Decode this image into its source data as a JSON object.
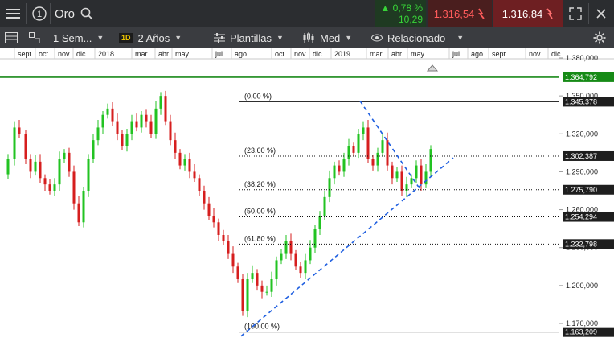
{
  "topbar": {
    "instrument": "Oro",
    "change_pct": "0,78 %",
    "change_abs": "10,29",
    "sell_price": "1.316,54",
    "buy_price": "1.316,84",
    "colors": {
      "sell_bg": "#4a1e1e",
      "buy_bg": "#6e1f22",
      "change_bg": "#1f3a22"
    }
  },
  "toolbar": {
    "period": "1 Sem...",
    "interval_badge": "1D",
    "range": "2 Años",
    "templates": "Plantillas",
    "chart_type": "Med",
    "related": "Relacionado"
  },
  "chart_data": {
    "type": "candlestick",
    "x_labels": [
      "sept.",
      "oct.",
      "nov.",
      "dic.",
      "2018",
      "mar.",
      "abr.",
      "may.",
      "jul.",
      "ago.",
      "oct.",
      "nov.",
      "dic.",
      "2019",
      "mar.",
      "abr.",
      "may.",
      "jul.",
      "ago.",
      "sept.",
      "nov.",
      "dic."
    ],
    "y_ticks": [
      "1.380,000",
      "1.350,000",
      "1.320,000",
      "1.290,000",
      "1.260,000",
      "1.230,000",
      "1.200,000",
      "1.170,000"
    ],
    "y_tick_values": [
      1380,
      1350,
      1320,
      1290,
      1260,
      1230,
      1200,
      1170
    ],
    "ylim": [
      1160,
      1390
    ],
    "price_tags": [
      {
        "label": "1.364,792",
        "value": 1364.792,
        "style": "green"
      },
      {
        "label": "1.345,378",
        "value": 1345.378,
        "style": "dark"
      },
      {
        "label": "1.302,387",
        "value": 1302.387,
        "style": "dark"
      },
      {
        "label": "1.275,790",
        "value": 1275.79,
        "style": "dark"
      },
      {
        "label": "1.254,294",
        "value": 1254.294,
        "style": "dark"
      },
      {
        "label": "1.232,798",
        "value": 1232.798,
        "style": "dark"
      },
      {
        "label": "1.163,209",
        "value": 1163.209,
        "style": "dark"
      }
    ],
    "fib_levels": [
      {
        "label": "(0,00 %)",
        "value": 1345.378,
        "line": "solid"
      },
      {
        "label": "(23,60 %)",
        "value": 1302.387,
        "line": "dotted"
      },
      {
        "label": "(38,20 %)",
        "value": 1275.79,
        "line": "dotted"
      },
      {
        "label": "(50,00 %)",
        "value": 1254.294,
        "line": "dotted"
      },
      {
        "label": "(61,80 %)",
        "value": 1232.798,
        "line": "dotted"
      },
      {
        "label": "(100,00 %)",
        "value": 1163.209,
        "line": "solid"
      }
    ],
    "colors": {
      "up": "#22c322",
      "down": "#d61e1e",
      "trend": "#1f5fe0",
      "resistance": "#1a8a1a"
    }
  }
}
